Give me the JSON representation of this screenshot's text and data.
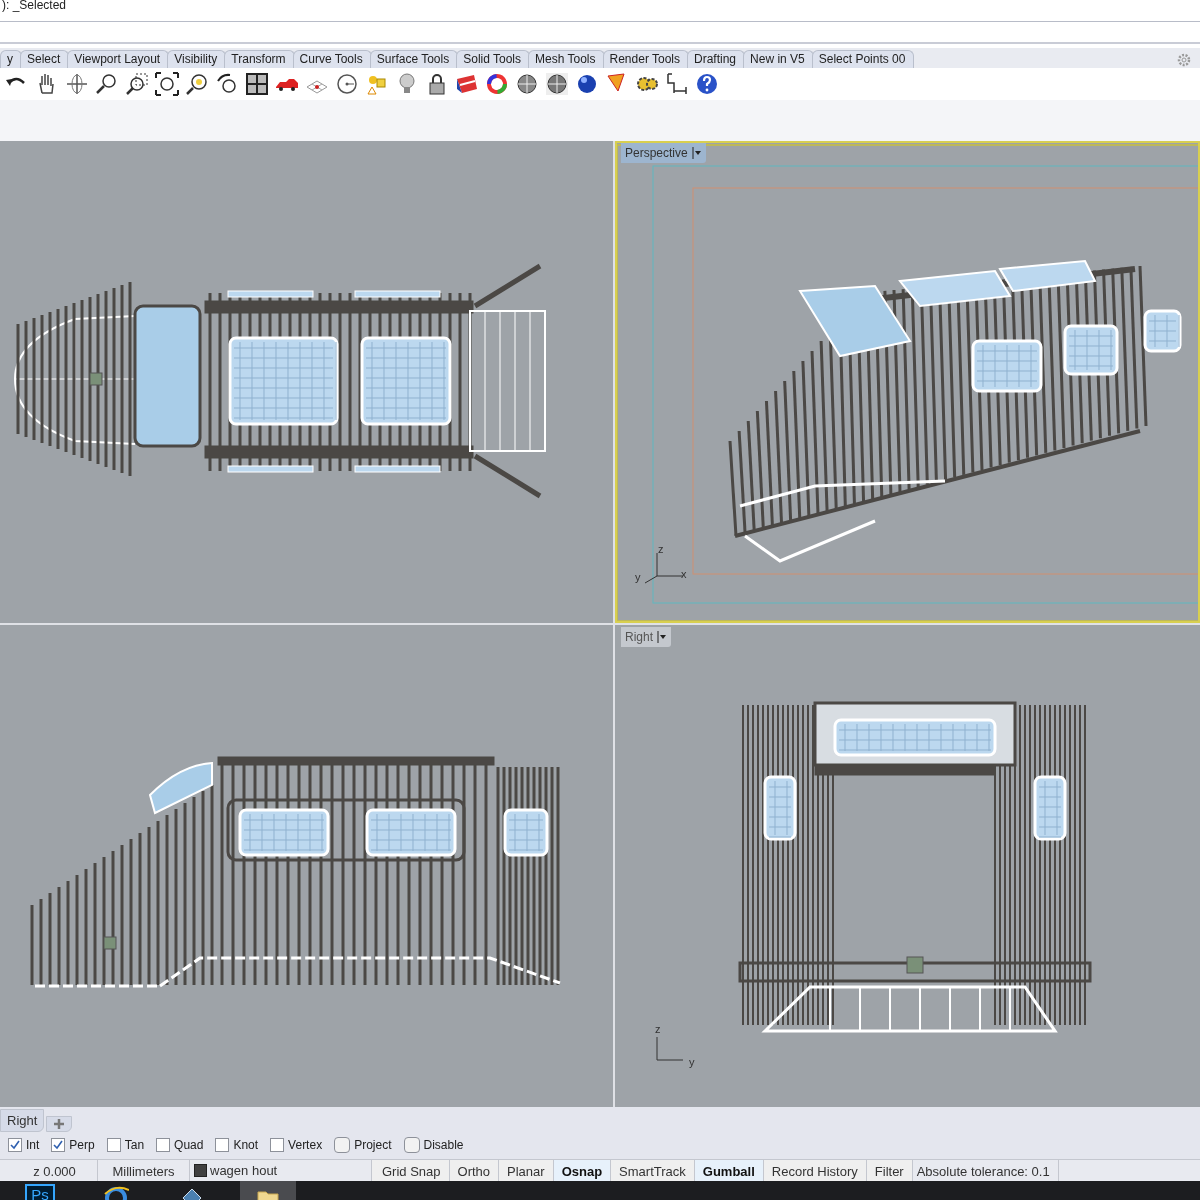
{
  "command_line": {
    "text": "): _Selected"
  },
  "toolbar_tabs": [
    {
      "label": "y"
    },
    {
      "label": "Select"
    },
    {
      "label": "Viewport Layout"
    },
    {
      "label": "Visibility"
    },
    {
      "label": "Transform"
    },
    {
      "label": "Curve Tools"
    },
    {
      "label": "Surface Tools"
    },
    {
      "label": "Solid Tools"
    },
    {
      "label": "Mesh Tools"
    },
    {
      "label": "Render Tools"
    },
    {
      "label": "Drafting"
    },
    {
      "label": "New in V5"
    },
    {
      "label": "Select Points 00"
    }
  ],
  "viewports": [
    {
      "kind": "top"
    },
    {
      "kind": "perspective",
      "label": "Perspective",
      "active": true,
      "axes": [
        "z",
        "y",
        "x"
      ]
    },
    {
      "kind": "front"
    },
    {
      "kind": "right",
      "label": "Right",
      "active": false,
      "axes": [
        "z",
        "y"
      ]
    }
  ],
  "viewport_tabs": [
    {
      "label": "Right"
    }
  ],
  "osnaps": [
    {
      "label": "Int",
      "checked": true
    },
    {
      "label": "Perp",
      "checked": true
    },
    {
      "label": "Tan",
      "checked": false
    },
    {
      "label": "Quad",
      "checked": false
    },
    {
      "label": "Knot",
      "checked": false
    },
    {
      "label": "Vertex",
      "checked": false
    },
    {
      "label": "Project",
      "checked": false,
      "kind": "round"
    },
    {
      "label": "Disable",
      "checked": false,
      "kind": "round"
    }
  ],
  "status_bar": {
    "coordinate": "z 0.000",
    "units": "Millimeters",
    "layer": {
      "name": "wagen hout",
      "color": "#404040"
    },
    "toggles": [
      {
        "label": "Grid Snap",
        "on": false
      },
      {
        "label": "Ortho",
        "on": false
      },
      {
        "label": "Planar",
        "on": false
      },
      {
        "label": "Osnap",
        "on": true
      },
      {
        "label": "SmartTrack",
        "on": false
      },
      {
        "label": "Gumball",
        "on": true
      },
      {
        "label": "Record History",
        "on": false
      },
      {
        "label": "Filter",
        "on": false
      }
    ],
    "tolerance": "Absolute tolerance: 0.1"
  },
  "taskbar": {
    "apps": [
      {
        "kind": "photoshop",
        "label": "Ps",
        "active": false
      },
      {
        "kind": "browser",
        "active": false
      },
      {
        "kind": "app",
        "active": false
      },
      {
        "kind": "folder",
        "active": true
      }
    ]
  }
}
